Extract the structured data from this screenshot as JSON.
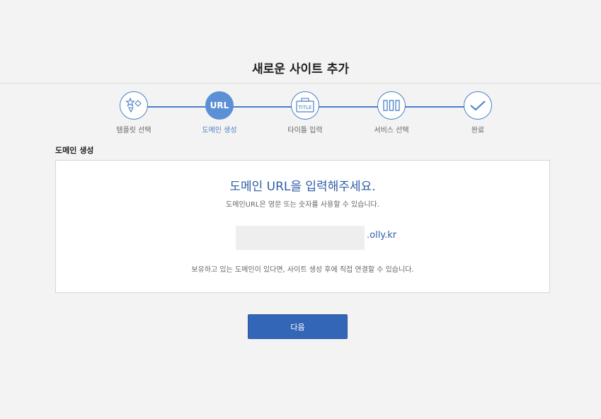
{
  "header": {
    "title": "새로운 사이트 추가"
  },
  "steps": [
    {
      "label": "템플릿 선택",
      "icon": "template-shapes-icon",
      "active": false
    },
    {
      "label": "도메인 생성",
      "icon_text": "URL",
      "active": true
    },
    {
      "label": "타이틀 입력",
      "icon": "title-icon",
      "icon_text": "TITLE",
      "active": false
    },
    {
      "label": "서비스 선택",
      "icon": "service-columns-icon",
      "active": false
    },
    {
      "label": "완료",
      "icon": "checkmark-icon",
      "active": false
    }
  ],
  "section": {
    "label": "도메인 생성"
  },
  "card": {
    "heading": "도메인 URL을 입력해주세요.",
    "sub": "도메인URL은 영문 또는 숫자를 사용할 수 있습니다.",
    "input_value": "",
    "suffix": ".olly.kr",
    "note": "보유하고 있는 도메인이 있다면, 사이트 생성 후에 직접 연결할 수 있습니다."
  },
  "actions": {
    "next_label": "다음"
  },
  "colors": {
    "accent": "#4a7fc8",
    "button": "#3466b8",
    "heading": "#2f5da6"
  }
}
